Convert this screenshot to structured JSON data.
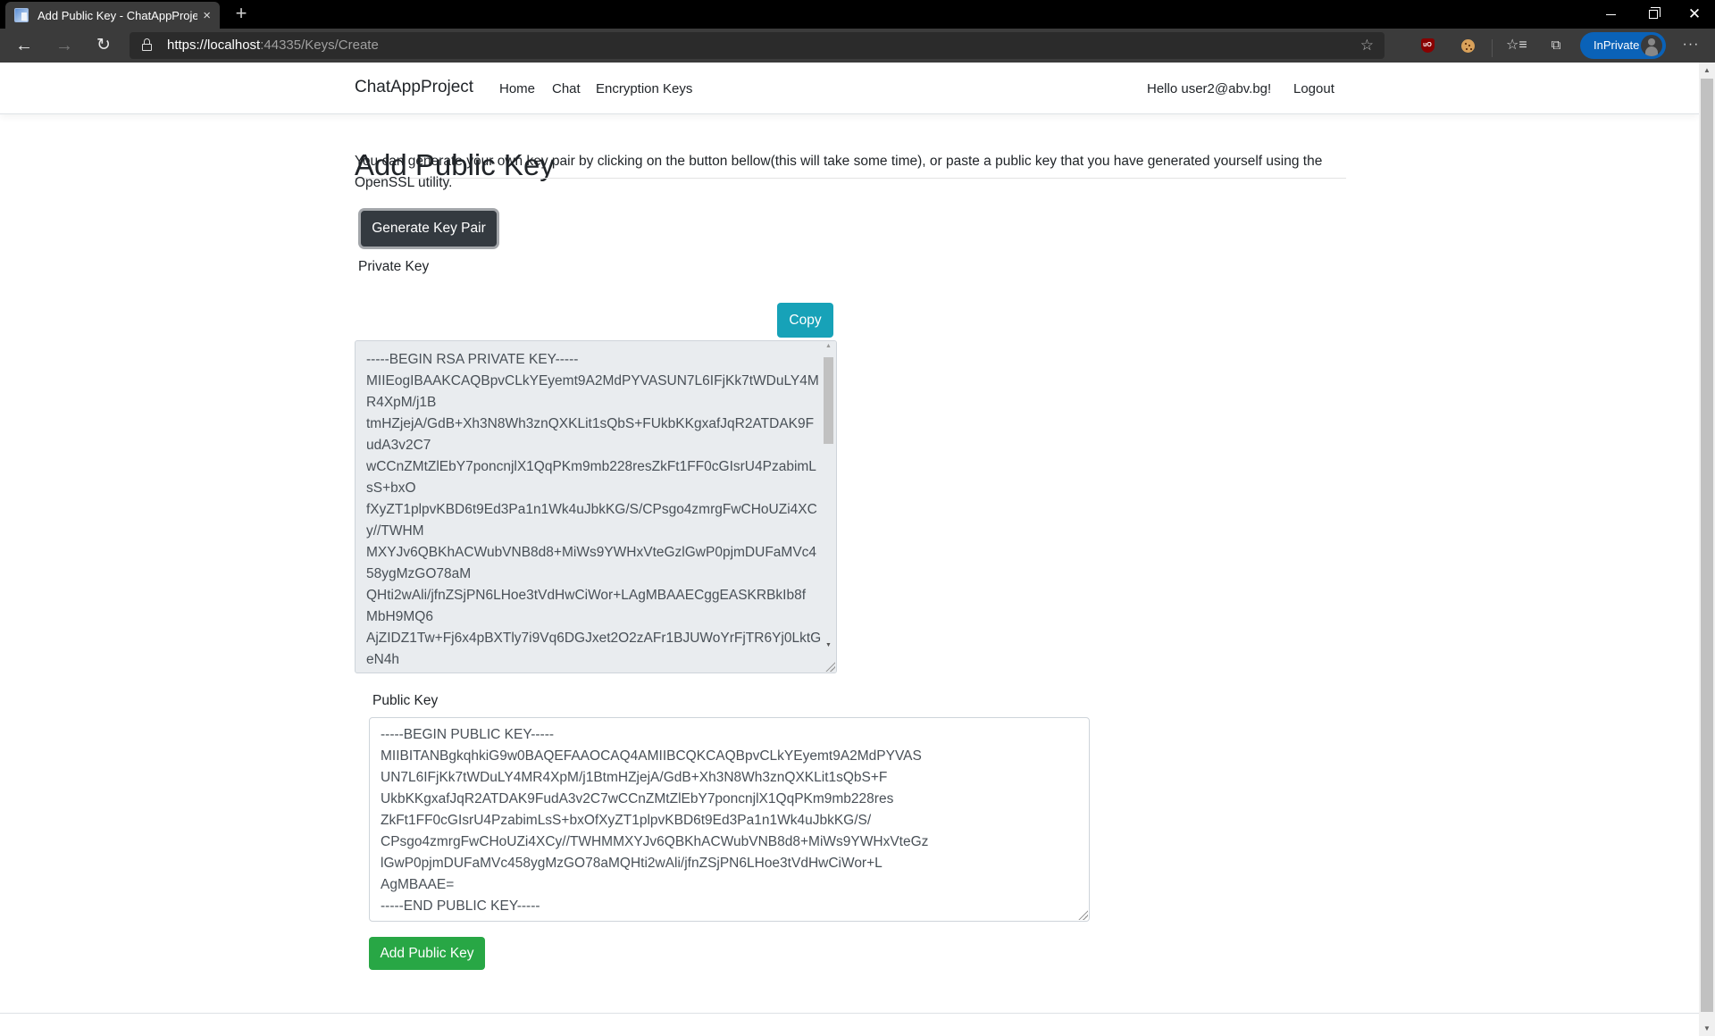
{
  "browser": {
    "tab_title": "Add Public Key - ChatAppProject",
    "tab_close": "×",
    "new_tab": "+",
    "url_scheme_host": "https://localhost",
    "url_rest": ":44335/Keys/Create",
    "inprivate_label": "InPrivate",
    "more_label": "···",
    "icons": {
      "back": "←",
      "forward": "→",
      "reload": "↻",
      "favorite_add": "☆",
      "favorites": "☆≡",
      "collections": "⧉",
      "ublock": "uO",
      "close_window": "✕"
    }
  },
  "navbar": {
    "brand": "ChatAppProject",
    "links": [
      {
        "label": "Home"
      },
      {
        "label": "Chat"
      },
      {
        "label": "Encryption Keys"
      }
    ],
    "greeting": "Hello user2@abv.bg!",
    "logout": "Logout"
  },
  "main": {
    "title": "Add Public Key",
    "intro": "You can generate your own key pair by clicking on the button bellow(this will take some time), or paste a public key that you have generated yourself using the OpenSSL utility.",
    "generate_button": "Generate Key Pair",
    "private_key": {
      "label": "Private Key",
      "copy_button": "Copy",
      "value": "-----BEGIN RSA PRIVATE KEY-----\nMIIEogIBAAKCAQBpvCLkYEyemt9A2MdPYVASUN7L6IFjKk7tWDuLY4M\nR4XpM/j1B\ntmHZjejA/GdB+Xh3N8Wh3znQXKLit1sQbS+FUkbKKgxafJqR2ATDAK9F\nudA3v2C7\nwCCnZMtZlEbY7poncnjlX1QqPKm9mb228resZkFt1FF0cGIsrU4PzabimL\nsS+bxO\nfXyZT1plpvKBD6t9Ed3Pa1n1Wk4uJbkKG/S/CPsgo4zmrgFwCHoUZi4XC\ny//TWHM\nMXYJv6QBKhACWubVNB8d8+MiWs9YWHxVteGzlGwP0pjmDUFaMVc4\n58ygMzGO78aM\nQHti2wAli/jfnZSjPN6LHoe3tVdHwCiWor+LAgMBAAECggEASKRBkIb8f\nMbH9MQ6\nAjZIDZ1Tw+Fj6x4pBXTly7i9Vq6DGJxet2O2zAFr1BJUWoYrFjTR6Yj0LktG\neN4h"
    },
    "public_key": {
      "label": "Public Key",
      "value": "-----BEGIN PUBLIC KEY-----\nMIIBITANBgkqhkiG9w0BAQEFAAOCAQ4AMIIBCQKCAQBpvCLkYEyemt9A2MdPYVAS\nUN7L6IFjKk7tWDuLY4MR4XpM/j1BtmHZjejA/GdB+Xh3N8Wh3znQXKLit1sQbS+F\nUkbKKgxafJqR2ATDAK9FudA3v2C7wCCnZMtZlEbY7poncnjlX1QqPKm9mb228res\nZkFt1FF0cGIsrU4PzabimLsS+bxOfXyZT1plpvKBD6t9Ed3Pa1n1Wk4uJbkKG/S/\nCPsgo4zmrgFwCHoUZi4XCy//TWHMMXYJv6QBKhACWubVNB8d8+MiWs9YWHxVteGz\nlGwP0pjmDUFaMVc458ygMzGO78aMQHti2wAli/jfnZSjPN6LHoe3tVdHwCiWor+L\nAgMBAAE=\n-----END PUBLIC KEY-----"
    },
    "add_button": "Add Public Key"
  },
  "colors": {
    "btn_dark": "#343a40",
    "btn_info": "#17a2b8",
    "btn_success": "#28a745",
    "inprivate": "#0a62b8"
  }
}
